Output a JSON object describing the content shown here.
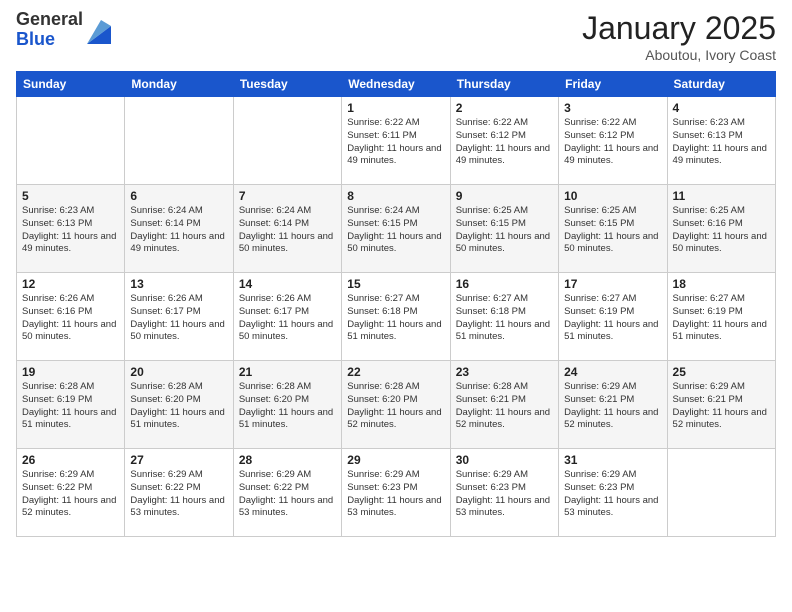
{
  "header": {
    "logo_general": "General",
    "logo_blue": "Blue",
    "month_title": "January 2025",
    "subtitle": "Aboutou, Ivory Coast"
  },
  "weekdays": [
    "Sunday",
    "Monday",
    "Tuesday",
    "Wednesday",
    "Thursday",
    "Friday",
    "Saturday"
  ],
  "weeks": [
    [
      {
        "day": "",
        "info": ""
      },
      {
        "day": "",
        "info": ""
      },
      {
        "day": "",
        "info": ""
      },
      {
        "day": "1",
        "info": "Sunrise: 6:22 AM\nSunset: 6:11 PM\nDaylight: 11 hours and 49 minutes."
      },
      {
        "day": "2",
        "info": "Sunrise: 6:22 AM\nSunset: 6:12 PM\nDaylight: 11 hours and 49 minutes."
      },
      {
        "day": "3",
        "info": "Sunrise: 6:22 AM\nSunset: 6:12 PM\nDaylight: 11 hours and 49 minutes."
      },
      {
        "day": "4",
        "info": "Sunrise: 6:23 AM\nSunset: 6:13 PM\nDaylight: 11 hours and 49 minutes."
      }
    ],
    [
      {
        "day": "5",
        "info": "Sunrise: 6:23 AM\nSunset: 6:13 PM\nDaylight: 11 hours and 49 minutes."
      },
      {
        "day": "6",
        "info": "Sunrise: 6:24 AM\nSunset: 6:14 PM\nDaylight: 11 hours and 49 minutes."
      },
      {
        "day": "7",
        "info": "Sunrise: 6:24 AM\nSunset: 6:14 PM\nDaylight: 11 hours and 50 minutes."
      },
      {
        "day": "8",
        "info": "Sunrise: 6:24 AM\nSunset: 6:15 PM\nDaylight: 11 hours and 50 minutes."
      },
      {
        "day": "9",
        "info": "Sunrise: 6:25 AM\nSunset: 6:15 PM\nDaylight: 11 hours and 50 minutes."
      },
      {
        "day": "10",
        "info": "Sunrise: 6:25 AM\nSunset: 6:15 PM\nDaylight: 11 hours and 50 minutes."
      },
      {
        "day": "11",
        "info": "Sunrise: 6:25 AM\nSunset: 6:16 PM\nDaylight: 11 hours and 50 minutes."
      }
    ],
    [
      {
        "day": "12",
        "info": "Sunrise: 6:26 AM\nSunset: 6:16 PM\nDaylight: 11 hours and 50 minutes."
      },
      {
        "day": "13",
        "info": "Sunrise: 6:26 AM\nSunset: 6:17 PM\nDaylight: 11 hours and 50 minutes."
      },
      {
        "day": "14",
        "info": "Sunrise: 6:26 AM\nSunset: 6:17 PM\nDaylight: 11 hours and 50 minutes."
      },
      {
        "day": "15",
        "info": "Sunrise: 6:27 AM\nSunset: 6:18 PM\nDaylight: 11 hours and 51 minutes."
      },
      {
        "day": "16",
        "info": "Sunrise: 6:27 AM\nSunset: 6:18 PM\nDaylight: 11 hours and 51 minutes."
      },
      {
        "day": "17",
        "info": "Sunrise: 6:27 AM\nSunset: 6:19 PM\nDaylight: 11 hours and 51 minutes."
      },
      {
        "day": "18",
        "info": "Sunrise: 6:27 AM\nSunset: 6:19 PM\nDaylight: 11 hours and 51 minutes."
      }
    ],
    [
      {
        "day": "19",
        "info": "Sunrise: 6:28 AM\nSunset: 6:19 PM\nDaylight: 11 hours and 51 minutes."
      },
      {
        "day": "20",
        "info": "Sunrise: 6:28 AM\nSunset: 6:20 PM\nDaylight: 11 hours and 51 minutes."
      },
      {
        "day": "21",
        "info": "Sunrise: 6:28 AM\nSunset: 6:20 PM\nDaylight: 11 hours and 51 minutes."
      },
      {
        "day": "22",
        "info": "Sunrise: 6:28 AM\nSunset: 6:20 PM\nDaylight: 11 hours and 52 minutes."
      },
      {
        "day": "23",
        "info": "Sunrise: 6:28 AM\nSunset: 6:21 PM\nDaylight: 11 hours and 52 minutes."
      },
      {
        "day": "24",
        "info": "Sunrise: 6:29 AM\nSunset: 6:21 PM\nDaylight: 11 hours and 52 minutes."
      },
      {
        "day": "25",
        "info": "Sunrise: 6:29 AM\nSunset: 6:21 PM\nDaylight: 11 hours and 52 minutes."
      }
    ],
    [
      {
        "day": "26",
        "info": "Sunrise: 6:29 AM\nSunset: 6:22 PM\nDaylight: 11 hours and 52 minutes."
      },
      {
        "day": "27",
        "info": "Sunrise: 6:29 AM\nSunset: 6:22 PM\nDaylight: 11 hours and 53 minutes."
      },
      {
        "day": "28",
        "info": "Sunrise: 6:29 AM\nSunset: 6:22 PM\nDaylight: 11 hours and 53 minutes."
      },
      {
        "day": "29",
        "info": "Sunrise: 6:29 AM\nSunset: 6:23 PM\nDaylight: 11 hours and 53 minutes."
      },
      {
        "day": "30",
        "info": "Sunrise: 6:29 AM\nSunset: 6:23 PM\nDaylight: 11 hours and 53 minutes."
      },
      {
        "day": "31",
        "info": "Sunrise: 6:29 AM\nSunset: 6:23 PM\nDaylight: 11 hours and 53 minutes."
      },
      {
        "day": "",
        "info": ""
      }
    ]
  ]
}
